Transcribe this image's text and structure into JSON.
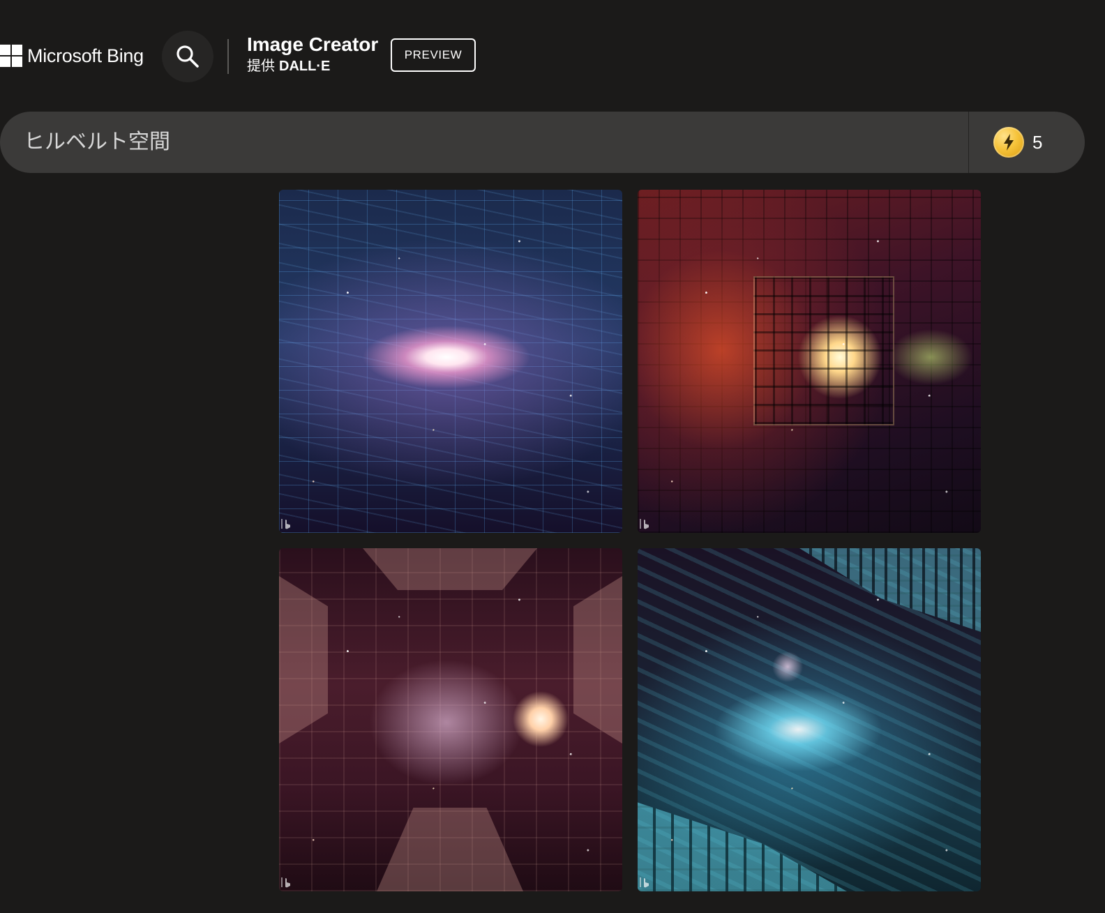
{
  "header": {
    "brand": "Microsoft Bing",
    "product_title": "Image Creator",
    "product_provider": "提供",
    "product_engine": "DALL·E",
    "badge": "PREVIEW",
    "icons": {
      "logo": "windows-logo-icon",
      "search": "search-icon"
    }
  },
  "prompt": {
    "value": "ヒルベルト空間",
    "boosts": {
      "count": "5",
      "icon": "boost-lightning-icon"
    }
  },
  "results": {
    "images": [
      {
        "icon": "bing-watermark-icon"
      },
      {
        "icon": "bing-watermark-icon"
      },
      {
        "icon": "bing-watermark-icon"
      },
      {
        "icon": "bing-watermark-icon"
      }
    ]
  },
  "colors": {
    "background": "#1b1a19",
    "prompt_bar": "#3b3a39",
    "boost_coin": "#f6c33a",
    "text": "#ffffff"
  }
}
